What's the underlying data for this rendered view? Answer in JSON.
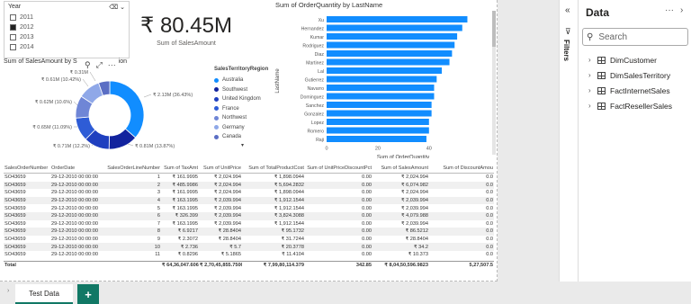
{
  "slicer": {
    "title": "Year",
    "options": [
      {
        "label": "2011",
        "checked": false
      },
      {
        "label": "2012",
        "checked": true
      },
      {
        "label": "2013",
        "checked": false
      },
      {
        "label": "2014",
        "checked": false
      }
    ]
  },
  "kpi": {
    "value": "₹ 80.45M",
    "label": "Sum of SalesAmount"
  },
  "donut": {
    "title": "Sum of SalesAmount by SalesTerritoryRegion",
    "title_visible": "Sum of SalesAmount by S",
    "title_tail": "ion",
    "legend_title": "SalesTerritoryRegion",
    "legend": [
      "Australia",
      "Southwest",
      "United Kingdom",
      "France",
      "Northwest",
      "Germany",
      "Canada"
    ],
    "legend_colors": [
      "#118DFF",
      "#12239E",
      "#1F3FBF",
      "#2E5CD6",
      "#6F86D6",
      "#8FA8E8",
      "#5B6EC4"
    ],
    "labels": {
      "a": "₹ 2.13M (36.43%)",
      "b": "₹ 0.81M (13.87%)",
      "c": "₹ 0.71M (12.2%)",
      "d": "₹ 0.65M (11.09%)",
      "e": "₹ 0.62M (10.6%)",
      "f": "₹ 0.61M (10.42%)",
      "g": "₹ 0.31M"
    }
  },
  "bar": {
    "title": "Sum of OrderQuantity by LastName",
    "xlabel": "Sum of OrderQuantity",
    "ylabel": "LastName"
  },
  "chart_data": [
    {
      "type": "pie",
      "title": "Sum of SalesAmount by SalesTerritoryRegion",
      "categories": [
        "Australia",
        "Southwest",
        "United Kingdom",
        "France",
        "Northwest",
        "Germany",
        "Canada"
      ],
      "values": [
        2.13,
        0.81,
        0.71,
        0.65,
        0.62,
        0.61,
        0.31
      ],
      "percentages": [
        36.43,
        13.87,
        12.2,
        11.09,
        10.6,
        10.42,
        null
      ]
    },
    {
      "type": "bar",
      "orientation": "horizontal",
      "title": "Sum of OrderQuantity by LastName",
      "xlabel": "Sum of OrderQuantity",
      "ylabel": "LastName",
      "categories": [
        "Xu",
        "Hernandez",
        "Kumar",
        "Rodriguez",
        "Diaz",
        "Martinez",
        "Lal",
        "Gutierrez",
        "Navarro",
        "Dominguez",
        "Sanchez",
        "Gonzalez",
        "Lopez",
        "Romero",
        "Raji"
      ],
      "values": [
        55,
        53,
        51,
        50,
        49,
        48,
        45,
        43,
        42,
        42,
        41,
        41,
        40,
        40,
        39
      ],
      "xlim": [
        0,
        58
      ],
      "xticks": [
        "0",
        "20",
        "40"
      ]
    }
  ],
  "table": {
    "headers": [
      "SalesOrderNumber",
      "OrderDate",
      "SalesOrderLineNumber",
      "Sum of TaxAmt",
      "Sum of UnitPrice",
      "Sum of TotalProductCost",
      "Sum of UnitPriceDiscountPct",
      "Sum of SalesAmount",
      "Sum of DiscountAmou"
    ],
    "rows": [
      [
        "SO43659",
        "29-12-2010 00:00:00",
        "1",
        "₹ 161.9995",
        "₹ 2,024.994",
        "₹ 1,898.0944",
        "0.00",
        "₹ 2,024.994",
        "0.0"
      ],
      [
        "SO43659",
        "29-12-2010 00:00:00",
        "2",
        "₹ 485.9986",
        "₹ 2,024.994",
        "₹ 5,694.2832",
        "0.00",
        "₹ 6,074.982",
        "0.0"
      ],
      [
        "SO43659",
        "29-12-2010 00:00:00",
        "3",
        "₹ 161.9995",
        "₹ 2,024.994",
        "₹ 1,898.0944",
        "0.00",
        "₹ 2,024.994",
        "0.0"
      ],
      [
        "SO43659",
        "29-12-2010 00:00:00",
        "4",
        "₹ 163.1995",
        "₹ 2,039.994",
        "₹ 1,912.1544",
        "0.00",
        "₹ 2,039.994",
        "0.0"
      ],
      [
        "SO43659",
        "29-12-2010 00:00:00",
        "5",
        "₹ 163.1995",
        "₹ 2,039.994",
        "₹ 1,912.1544",
        "0.00",
        "₹ 2,039.994",
        "0.0"
      ],
      [
        "SO43659",
        "29-12-2010 00:00:00",
        "6",
        "₹ 326.399",
        "₹ 2,039.994",
        "₹ 3,824.3088",
        "0.00",
        "₹ 4,079.988",
        "0.0"
      ],
      [
        "SO43659",
        "29-12-2010 00:00:00",
        "7",
        "₹ 163.1995",
        "₹ 2,039.994",
        "₹ 1,912.1544",
        "0.00",
        "₹ 2,039.994",
        "0.0"
      ],
      [
        "SO43659",
        "29-12-2010 00:00:00",
        "8",
        "₹ 6.9217",
        "₹ 28.8404",
        "₹ 95.1732",
        "0.00",
        "₹ 86.5212",
        "0.0"
      ],
      [
        "SO43659",
        "29-12-2010 00:00:00",
        "9",
        "₹ 2.3072",
        "₹ 28.8404",
        "₹ 31.7244",
        "0.00",
        "₹ 28.8404",
        "0.0"
      ],
      [
        "SO43659",
        "29-12-2010 00:00:00",
        "10",
        "₹ 2.736",
        "₹ 5.7",
        "₹ 20.3778",
        "0.00",
        "₹ 34.2",
        "0.0"
      ],
      [
        "SO43659",
        "29-12-2010 00:00:00",
        "11",
        "₹ 0.8296",
        "₹ 5.1865",
        "₹ 11.4104",
        "0.00",
        "₹ 10.373",
        "0.0"
      ]
    ],
    "total": [
      "Total",
      "",
      "",
      "₹ 64,36,047.6066",
      "₹ 2,70,45,855.7506",
      "₹ 7,99,80,114.379",
      "342.85",
      "₹ 8,04,50,596.9823",
      "5,27,507.5"
    ]
  },
  "tabs": {
    "active": "Test Data",
    "add": "+"
  },
  "filters": {
    "label": "Filters"
  },
  "data_pane": {
    "title": "Data",
    "search_placeholder": "Search",
    "tables": [
      "DimCustomer",
      "DimSalesTerritory",
      "FactInternetSales",
      "FactResellerSales"
    ]
  }
}
